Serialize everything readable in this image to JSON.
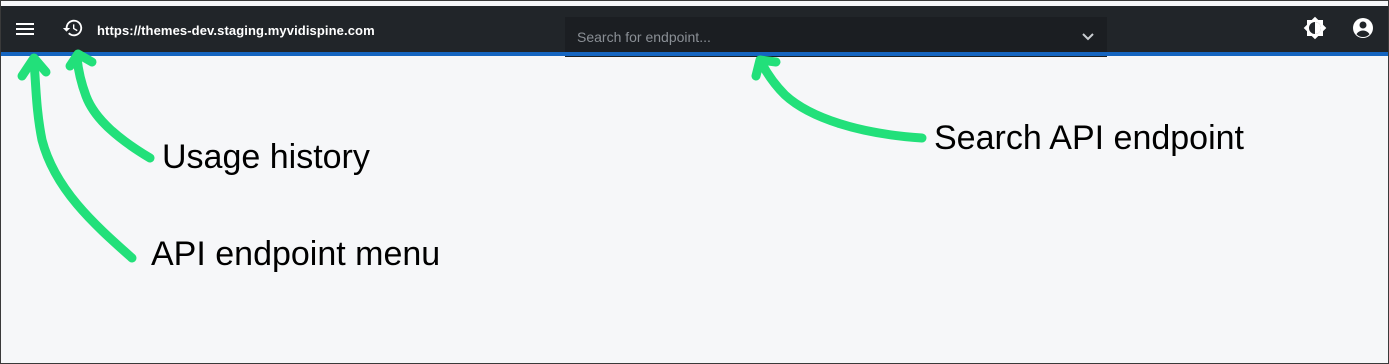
{
  "header": {
    "menu_icon": "hamburger-menu-icon",
    "history_icon": "history-icon",
    "server_url": "https://themes-dev.staging.myvidispine.com",
    "search": {
      "placeholder": "Search for endpoint...",
      "value": "",
      "chevron_icon": "chevron-down-icon"
    },
    "theme_icon": "brightness-icon",
    "account_icon": "account-circle-icon"
  },
  "annotations": {
    "menu": "API endpoint menu",
    "history": "Usage history",
    "search": "Search API endpoint"
  },
  "colors": {
    "topbar": "#212529",
    "accent": "#1565c0",
    "background": "#f6f7f9",
    "annotation_arrow": "#22e07a"
  }
}
